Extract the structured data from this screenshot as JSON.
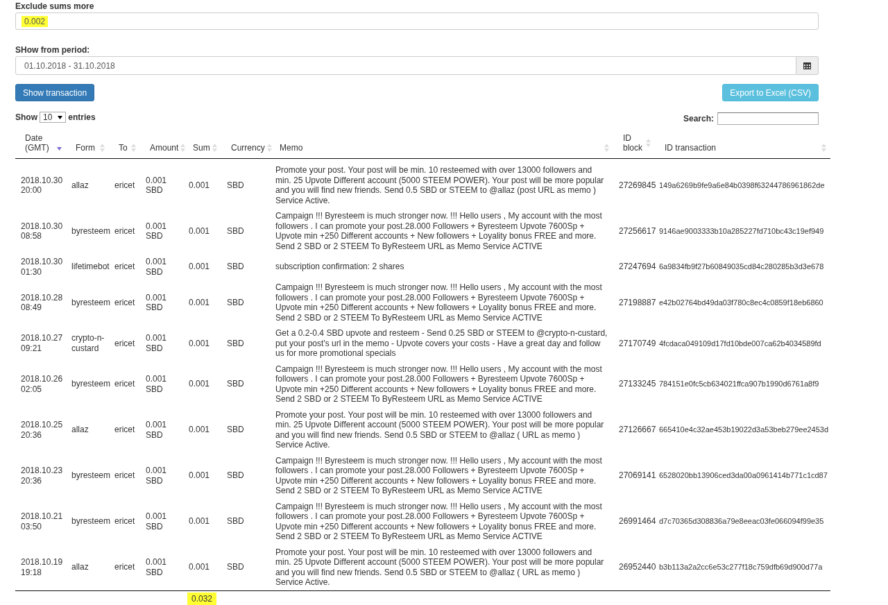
{
  "exclude_filter": {
    "label": "Exclude sums more",
    "value": "0.002",
    "highlighted": true
  },
  "period_filter": {
    "label": "SHow from period:",
    "value": "01.10.2018 - 31.10.2018"
  },
  "buttons": {
    "show": "Show transaction",
    "export": "Export to Excel (CSV)"
  },
  "length_control": {
    "prefix": "Show",
    "value": "10",
    "suffix": "entries"
  },
  "search": {
    "label": "Search:"
  },
  "table": {
    "columns": [
      {
        "label": "Date (GMT)",
        "sorted": true
      },
      {
        "label": "Form",
        "sorted": false
      },
      {
        "label": "To",
        "sorted": false
      },
      {
        "label": "Amount",
        "sorted": false
      },
      {
        "label": "Sum",
        "sorted": false
      },
      {
        "label": "Currency",
        "sorted": false
      },
      {
        "label": "Memo",
        "sorted": false
      },
      {
        "label": "ID block",
        "sorted": false
      },
      {
        "label": "ID transaction",
        "sorted": false
      }
    ],
    "rows": [
      [
        "2018.10.30 20:00",
        "allaz",
        "ericet",
        "0.001 SBD",
        "0.001",
        "SBD",
        "Promote your post. Your post will be min. 10 resteemed with over 13000 followers and min. 25 Upvote Different account (5000 STEEM POWER). Your post will be more popular and you will find new friends. Send 0.5 SBD or STEEM to @allaz (post URL as memo ) Service Active.",
        "27269845",
        "149a6269b9fe9a6e84b0398f63244786961862de"
      ],
      [
        "2018.10.30 08:58",
        "byresteem",
        "ericet",
        "0.001 SBD",
        "0.001",
        "SBD",
        "Campaign !!! Byresteem is much stronger now. !!! Hello users , My account with the most followers . I can promote your post.28.000 Followers + Byresteem Upvote 7600Sp + Upvote min +250 Different accounts + New followers + Loyality bonus FREE and more. Send 2 SBD or 2 STEEM To ByResteem URL as Memo Service ACTIVE",
        "27256617",
        "9146ae9003333b10a285227fd710bc43c19ef949"
      ],
      [
        "2018.10.30 01:30",
        "lifetimebot",
        "ericet",
        "0.001 SBD",
        "0.001",
        "SBD",
        "subscription confirmation: 2 shares",
        "27247694",
        "6a9834fb9f27b60849035cd84c280285b3d3e678"
      ],
      [
        "2018.10.28 08:49",
        "byresteem",
        "ericet",
        "0.001 SBD",
        "0.001",
        "SBD",
        "Campaign !!! Byresteem is much stronger now. !!! Hello users , My account with the most followers . I can promote your post.28.000 Followers + Byresteem Upvote 7600Sp + Upvote min +250 Different accounts + New followers + Loyality bonus FREE and more. Send 2 SBD or 2 STEEM To ByResteem URL as Memo Service ACTIVE",
        "27198887",
        "e42b02764bd49da03f780c8ec4c0859f18eb6860"
      ],
      [
        "2018.10.27 09:21",
        "crypto-n-custard",
        "ericet",
        "0.001 SBD",
        "0.001",
        "SBD",
        "Get a 0.2-0.4 SBD upvote and resteem - Send 0.25 SBD or STEEM to @crypto-n-custard, put your post's url in the memo - Upvote covers your costs - Have a great day and follow us for more promotional specials",
        "27170749",
        "4fcdaca049109d17fd10bde007ca62b4034589fd"
      ],
      [
        "2018.10.26 02:05",
        "byresteem",
        "ericet",
        "0.001 SBD",
        "0.001",
        "SBD",
        "Campaign !!! Byresteem is much stronger now. !!! Hello users , My account with the most followers . I can promote your post.28.000 Followers + Byresteem Upvote 7600Sp + Upvote min +250 Different accounts + New followers + Loyality bonus FREE and more. Send 2 SBD or 2 STEEM To ByResteem URL as Memo Service ACTIVE",
        "27133245",
        "784151e0fc5cb634021ffca907b1990d6761a8f9"
      ],
      [
        "2018.10.25 20:36",
        "allaz",
        "ericet",
        "0.001 SBD",
        "0.001",
        "SBD",
        "Promote your post. Your post will be min. 10 resteemed with over 13000 followers and min. 25 Upvote Different account (5000 STEEM POWER). Your post will be more popular and you will find new friends. Send 0.5 SBD or STEEM to @allaz ( URL as memo ) Service Active.",
        "27126667",
        "665410e4c32ae453b19022d3a53beb279ee2453d"
      ],
      [
        "2018.10.23 20:36",
        "byresteem",
        "ericet",
        "0.001 SBD",
        "0.001",
        "SBD",
        "Campaign !!! Byresteem is much stronger now. !!! Hello users , My account with the most followers . I can promote your post.28.000 Followers + Byresteem Upvote 7600Sp + Upvote min +250 Different accounts + New followers + Loyality bonus FREE and more. Send 2 SBD or 2 STEEM To ByResteem URL as Memo Service ACTIVE",
        "27069141",
        "6528020bb13906ced3da00a0961414b771c1cd87"
      ],
      [
        "2018.10.21 03:50",
        "byresteem",
        "ericet",
        "0.001 SBD",
        "0.001",
        "SBD",
        "Campaign !!! Byresteem is much stronger now. !!! Hello users , My account with the most followers . I can promote your post.28.000 Followers + Byresteem Upvote 7600Sp + Upvote min +250 Different accounts + New followers + Loyality bonus FREE and more. Send 2 SBD or 2 STEEM To ByResteem URL as Memo Service ACTIVE",
        "26991464",
        "d7c70365d308836a79e8eeac03fe066094f99e35"
      ],
      [
        "2018.10.19 19:18",
        "allaz",
        "ericet",
        "0.001 SBD",
        "0.001",
        "SBD",
        "Promote your post. Your post will be min. 10 resteemed with over 13000 followers and min. 25 Upvote Different account (5000 STEEM POWER). Your post will be more popular and you will find new friends. Send 0.5 SBD or STEEM to @allaz ( URL as memo ) Service Active.",
        "26952440",
        "b3b113a2a2cc6e53c277f18c759dfb69d900d77a"
      ]
    ],
    "total": {
      "value": "0.032",
      "highlighted": true
    }
  }
}
